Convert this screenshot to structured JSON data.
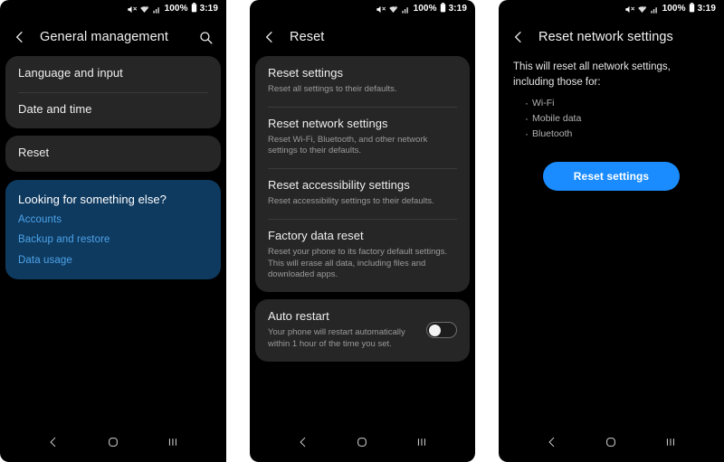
{
  "statusbar": {
    "mute_icon": "mute-icon",
    "wifi_icon": "wifi-icon",
    "signal_icon": "signal-icon",
    "battery_percent": "100%",
    "battery_icon": "battery-icon",
    "time": "3:19"
  },
  "navbar": {
    "back_icon": "back-icon",
    "home_icon": "home-icon",
    "recents_icon": "recents-icon"
  },
  "colors": {
    "accent_blue": "#1a8cff",
    "promo_card_bg": "#0e3a60",
    "promo_link": "#4da3e8",
    "card_bg": "#262626",
    "screen_bg": "#000000"
  },
  "panel1": {
    "back_icon": "back-icon",
    "title": "General management",
    "search_icon": "search-icon",
    "card1": [
      {
        "title": "Language and input"
      },
      {
        "title": "Date and time"
      }
    ],
    "card2": [
      {
        "title": "Reset"
      }
    ],
    "promo": {
      "title": "Looking for something else?",
      "links": [
        "Accounts",
        "Backup and restore",
        "Data usage"
      ]
    }
  },
  "panel2": {
    "back_icon": "back-icon",
    "title": "Reset",
    "card1": [
      {
        "title": "Reset settings",
        "subtitle": "Reset all settings to their defaults."
      },
      {
        "title": "Reset network settings",
        "subtitle": "Reset Wi-Fi, Bluetooth, and other network settings to their defaults."
      },
      {
        "title": "Reset accessibility settings",
        "subtitle": "Reset accessibility settings to their defaults."
      },
      {
        "title": "Factory data reset",
        "subtitle": "Reset your phone to its factory default settings. This will erase all data, including files and downloaded apps."
      }
    ],
    "card2": {
      "title": "Auto restart",
      "subtitle": "Your phone will restart automatically within 1 hour of the time you set.",
      "toggle_state": "off"
    }
  },
  "panel3": {
    "back_icon": "back-icon",
    "title": "Reset network settings",
    "description": "This will reset all network settings, including those for:",
    "bullets": [
      "Wi-Fi",
      "Mobile data",
      "Bluetooth"
    ],
    "cta_label": "Reset settings"
  }
}
